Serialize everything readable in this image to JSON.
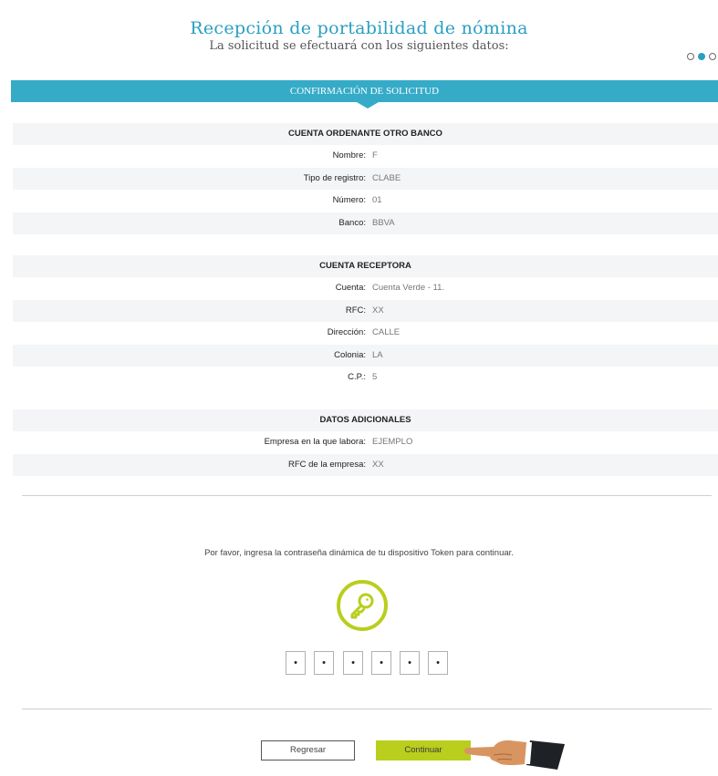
{
  "header": {
    "title": "Recepción de portabilidad de nómina",
    "subtitle": "La solicitud se efectuará con los siguientes datos:"
  },
  "steps": {
    "total": 3,
    "current": 2
  },
  "banner": {
    "label": "CONFIRMACIÓN DE SOLICITUD"
  },
  "sections": [
    {
      "title": "CUENTA ORDENANTE OTRO BANCO",
      "fields": [
        {
          "label": "Nombre:",
          "value": "F"
        },
        {
          "label": "Tipo de registro:",
          "value": "CLABE"
        },
        {
          "label": "Número:",
          "value": "01"
        },
        {
          "label": "Banco:",
          "value": "BBVA"
        }
      ]
    },
    {
      "title": "CUENTA RECEPTORA",
      "fields": [
        {
          "label": "Cuenta:",
          "value": "Cuenta Verde - 11."
        },
        {
          "label": "RFC:",
          "value": "XX"
        },
        {
          "label": "Dirección:",
          "value": "CALLE"
        },
        {
          "label": "Colonia:",
          "value": "LA"
        },
        {
          "label": "C.P.:",
          "value": "5"
        }
      ]
    },
    {
      "title": "DATOS ADICIONALES",
      "fields": [
        {
          "label": "Empresa en la que labora:",
          "value": "EJEMPLO"
        },
        {
          "label": "RFC de la empresa:",
          "value": "XX"
        }
      ]
    }
  ],
  "token": {
    "prompt": "Por favor, ingresa la contraseña dinámica de tu dispositivo Token para continuar.",
    "icon": "key-icon",
    "digits": [
      "•",
      "•",
      "•",
      "•",
      "•",
      "•"
    ]
  },
  "buttons": {
    "back": "Regresar",
    "continue": "Continuar"
  },
  "colors": {
    "accent": "#35abc8",
    "title": "#2a9fc0",
    "lime": "#b9ce1d"
  }
}
